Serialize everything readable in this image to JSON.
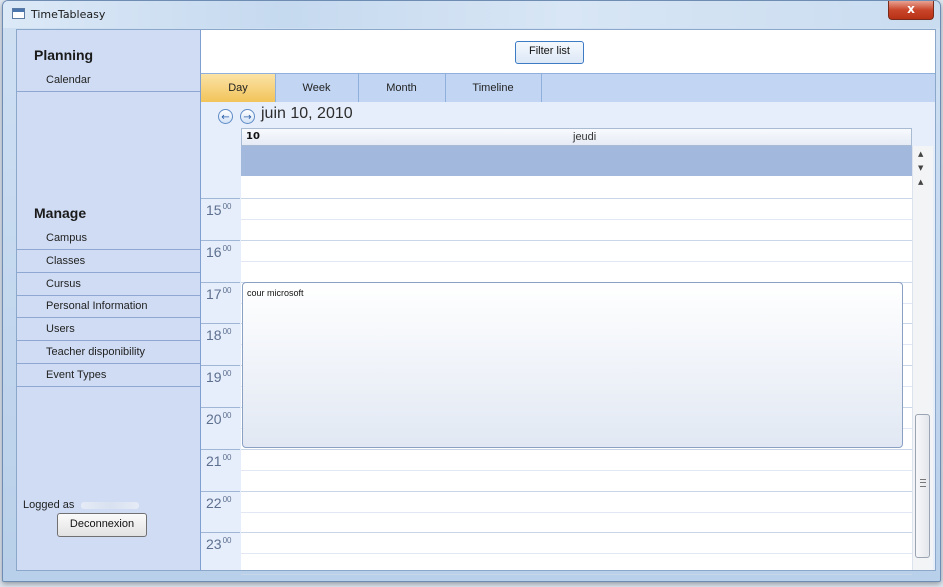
{
  "window": {
    "title": "TimeTableasy",
    "close_glyph": "x"
  },
  "sidebar": {
    "planning_title": "Planning",
    "planning_items": [
      {
        "label": "Calendar"
      }
    ],
    "manage_title": "Manage",
    "manage_items": [
      {
        "label": "Campus"
      },
      {
        "label": "Classes"
      },
      {
        "label": "Cursus"
      },
      {
        "label": "Personal Information"
      },
      {
        "label": "Users"
      },
      {
        "label": "Teacher disponibility"
      },
      {
        "label": "Event Types"
      }
    ],
    "logged_as_label": "Logged as",
    "deconnexion_label": "Deconnexion"
  },
  "toolbar": {
    "filter_label": "Filter list"
  },
  "tabs": [
    {
      "label": "Day",
      "active": true
    },
    {
      "label": "Week",
      "active": false
    },
    {
      "label": "Month",
      "active": false
    },
    {
      "label": "Timeline",
      "active": false
    }
  ],
  "calendar": {
    "date_title": "juin 10, 2010",
    "day_number": "10",
    "day_name": "jeudi",
    "hours": [
      {
        "hour": "15",
        "minutes": "00"
      },
      {
        "hour": "16",
        "minutes": "00"
      },
      {
        "hour": "17",
        "minutes": "00"
      },
      {
        "hour": "18",
        "minutes": "00"
      },
      {
        "hour": "19",
        "minutes": "00"
      },
      {
        "hour": "20",
        "minutes": "00"
      },
      {
        "hour": "21",
        "minutes": "00"
      },
      {
        "hour": "22",
        "minutes": "00"
      },
      {
        "hour": "23",
        "minutes": "00"
      }
    ],
    "event": {
      "title": "cour microsoft",
      "start": "17:00",
      "end": "21:00"
    }
  },
  "icons": {
    "prev": "arrow-left-icon",
    "next": "arrow-right-icon",
    "scroll_up": "chevron-up-icon",
    "scroll_down": "chevron-down-icon"
  },
  "colors": {
    "active_tab": "#f2c45a",
    "sidebar_bg": "#cfdcf3",
    "allday_band": "#a3b8dd",
    "close_button": "#c9452a"
  }
}
